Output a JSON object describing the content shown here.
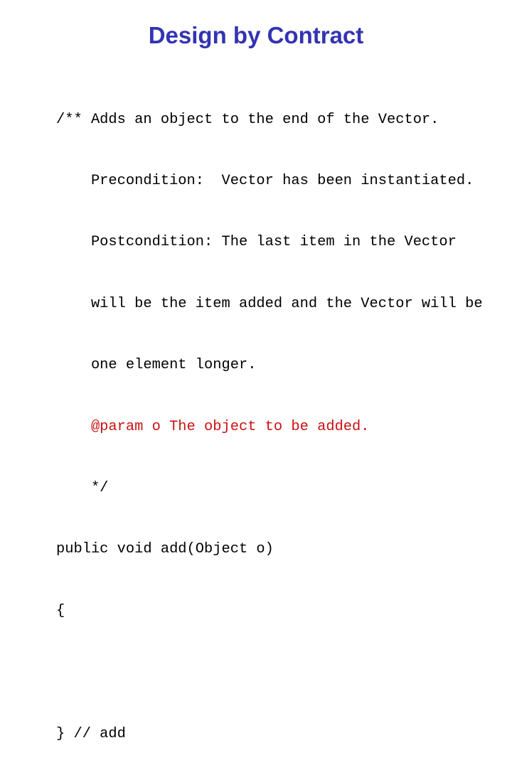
{
  "slide": {
    "title": "Design by Contract",
    "title_color": "#3333b3",
    "highlight_color": "#cc1111"
  },
  "code": {
    "lines": [
      {
        "text": "/** Adds an object to the end of the Vector.",
        "highlight": false
      },
      {
        "text": "    Precondition:  Vector has been instantiated.",
        "highlight": false
      },
      {
        "text": "    Postcondition: The last item in the Vector",
        "highlight": false
      },
      {
        "text": "    will be the item added and the Vector will be",
        "highlight": false
      },
      {
        "text": "    one element longer.",
        "highlight": false
      },
      {
        "text": "    @param o The object to be added.",
        "highlight": true
      },
      {
        "text": "    */",
        "highlight": false
      },
      {
        "text": "public void add(Object o)",
        "highlight": false
      },
      {
        "text": "{",
        "highlight": false
      },
      {
        "text": "",
        "highlight": false
      },
      {
        "text": "} // add",
        "highlight": false
      }
    ]
  }
}
